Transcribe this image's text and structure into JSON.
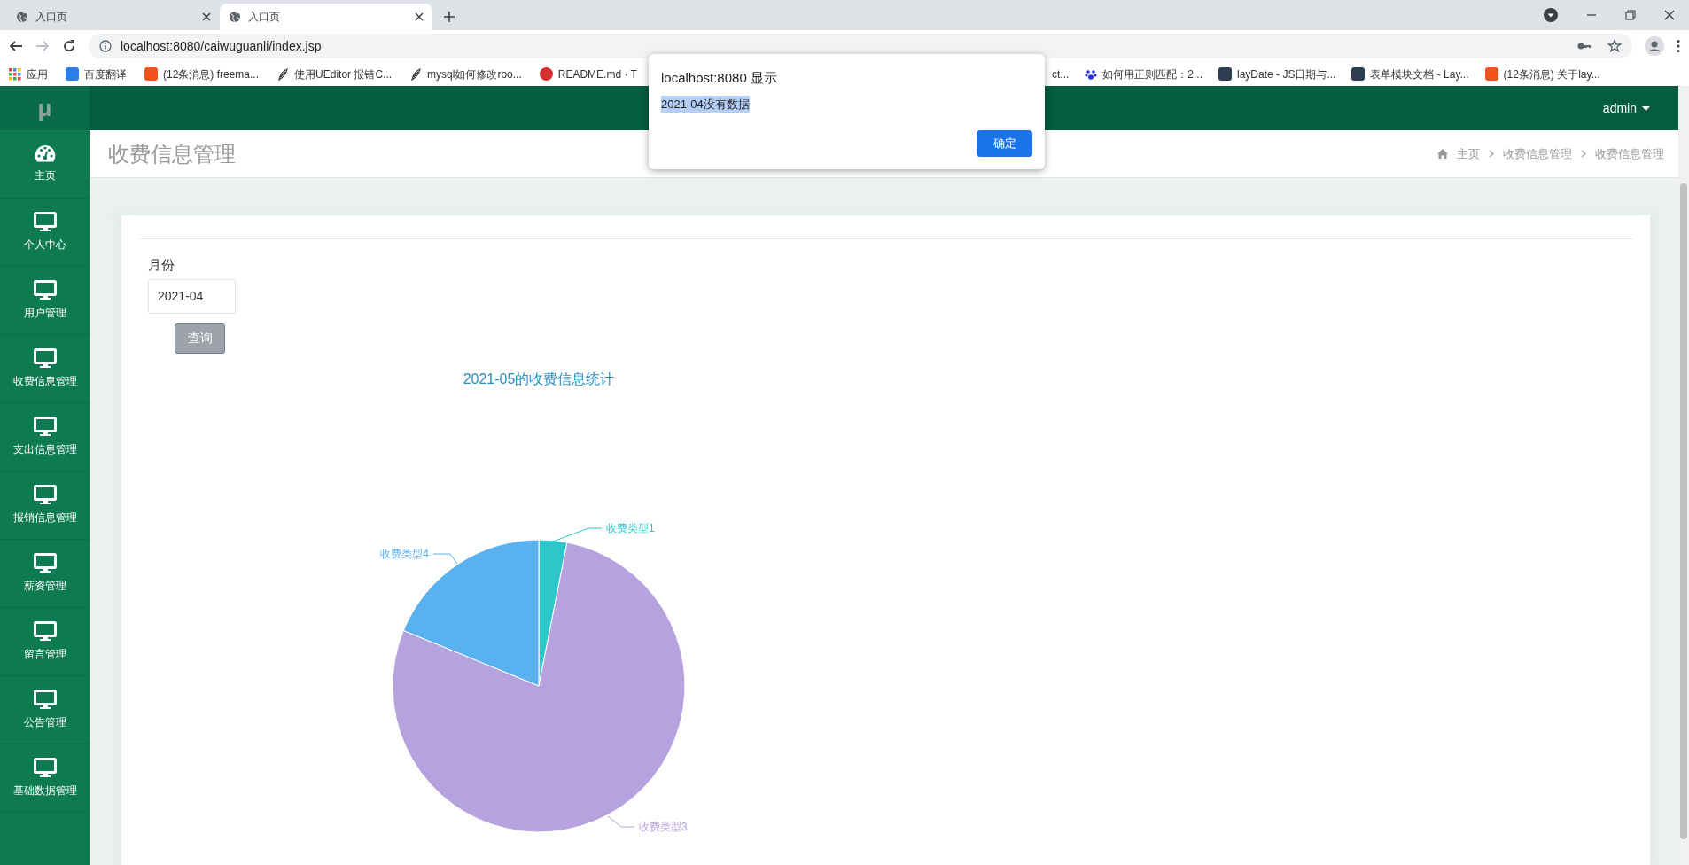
{
  "browser": {
    "tabs": [
      {
        "title": "入口页",
        "selected": false
      },
      {
        "title": "入口页",
        "selected": true
      }
    ],
    "url": "localhost:8080/caiwuguanli/index.jsp",
    "bookmarks": [
      {
        "kind": "grid",
        "label": "应用"
      },
      {
        "kind": "tile",
        "color": "#2b7de9",
        "label": "百度翻译"
      },
      {
        "kind": "tile",
        "color": "#f4511e",
        "label": "(12条消息) freema..."
      },
      {
        "kind": "feather",
        "label": "使用UEditor 报错C..."
      },
      {
        "kind": "feather",
        "label": "mysql如何修改roo..."
      },
      {
        "kind": "ring",
        "color": "#d32f2f",
        "label": "README.md · T"
      }
    ],
    "bookmarks_after_dialog": [
      {
        "kind": "none",
        "label": "ct..."
      },
      {
        "kind": "paw",
        "label": "如何用正则匹配：2..."
      },
      {
        "kind": "tile",
        "color": "#2d3e50",
        "label": "layDate - JS日期与..."
      },
      {
        "kind": "tile",
        "color": "#2d3e50",
        "label": "表单模块文档 - Lay..."
      },
      {
        "kind": "tile",
        "color": "#f4511e",
        "label": "(12条消息) 关于lay..."
      }
    ]
  },
  "dialog": {
    "title": "localhost:8080 显示",
    "message": "2021-04没有数据",
    "message_selected": true,
    "button": "确定"
  },
  "logo": "μ",
  "user": "admin",
  "sidebar": {
    "items": [
      {
        "kind": "dashboard",
        "label": "主页"
      },
      {
        "kind": "monitor",
        "label": "个人中心"
      },
      {
        "kind": "monitor",
        "label": "用户管理"
      },
      {
        "kind": "monitor",
        "label": "收费信息管理"
      },
      {
        "kind": "monitor",
        "label": "支出信息管理"
      },
      {
        "kind": "monitor",
        "label": "报销信息管理"
      },
      {
        "kind": "monitor",
        "label": "薪资管理"
      },
      {
        "kind": "monitor",
        "label": "留言管理"
      },
      {
        "kind": "monitor",
        "label": "公告管理"
      },
      {
        "kind": "monitor",
        "label": "基础数据管理"
      }
    ]
  },
  "page_title": "收费信息管理",
  "breadcrumb": [
    "主页",
    "收费信息管理",
    "收费信息管理"
  ],
  "form": {
    "label": "月份",
    "value": "2021-04",
    "button": "查询"
  },
  "chart": {
    "title": "2021-05的收费信息统计",
    "slices": [
      {
        "label": "收费类型1",
        "color": "#2ec7c9"
      },
      {
        "label": "收费类型3",
        "color": "#b6a2de"
      },
      {
        "label": "收费类型4",
        "color": "#5ab1ef"
      }
    ]
  }
}
